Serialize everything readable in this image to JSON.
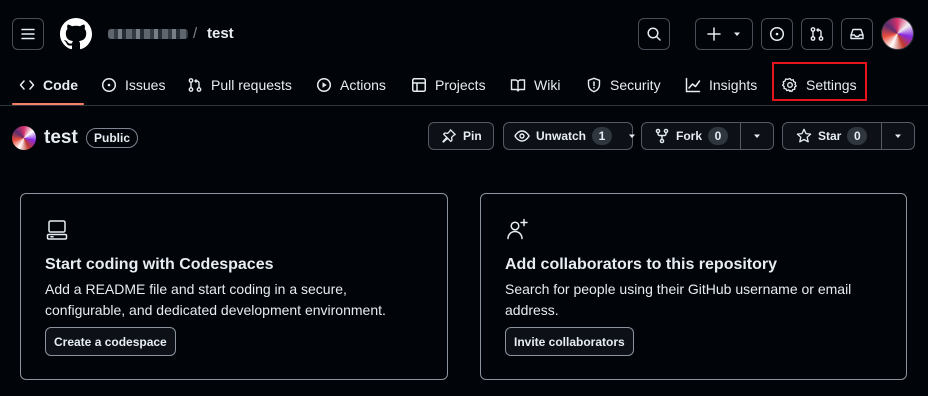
{
  "header": {
    "repo_name": "test",
    "separator": "/"
  },
  "tabs": [
    {
      "label": "Code",
      "icon": "code-icon"
    },
    {
      "label": "Issues",
      "icon": "issue-opened-icon"
    },
    {
      "label": "Pull requests",
      "icon": "git-pull-request-icon"
    },
    {
      "label": "Actions",
      "icon": "play-icon"
    },
    {
      "label": "Projects",
      "icon": "table-icon"
    },
    {
      "label": "Wiki",
      "icon": "book-icon"
    },
    {
      "label": "Security",
      "icon": "shield-icon"
    },
    {
      "label": "Insights",
      "icon": "graph-icon"
    },
    {
      "label": "Settings",
      "icon": "gear-icon"
    }
  ],
  "repo": {
    "name": "test",
    "visibility": "Public",
    "pin_label": "Pin",
    "watch_label": "Unwatch",
    "watch_count": "1",
    "fork_label": "Fork",
    "fork_count": "0",
    "star_label": "Star",
    "star_count": "0"
  },
  "cards": {
    "codespaces": {
      "title": "Start coding with Codespaces",
      "description": "Add a README file and start coding in a secure, configurable, and dedicated development environment.",
      "button": "Create a codespace"
    },
    "collaborators": {
      "title": "Add collaborators to this repository",
      "description": "Search for people using their GitHub username or email address.",
      "button": "Invite collaborators"
    }
  },
  "colors": {
    "background": "#010409",
    "selected_tab_underline": "#f78166",
    "highlight_box": "#e5141d"
  }
}
